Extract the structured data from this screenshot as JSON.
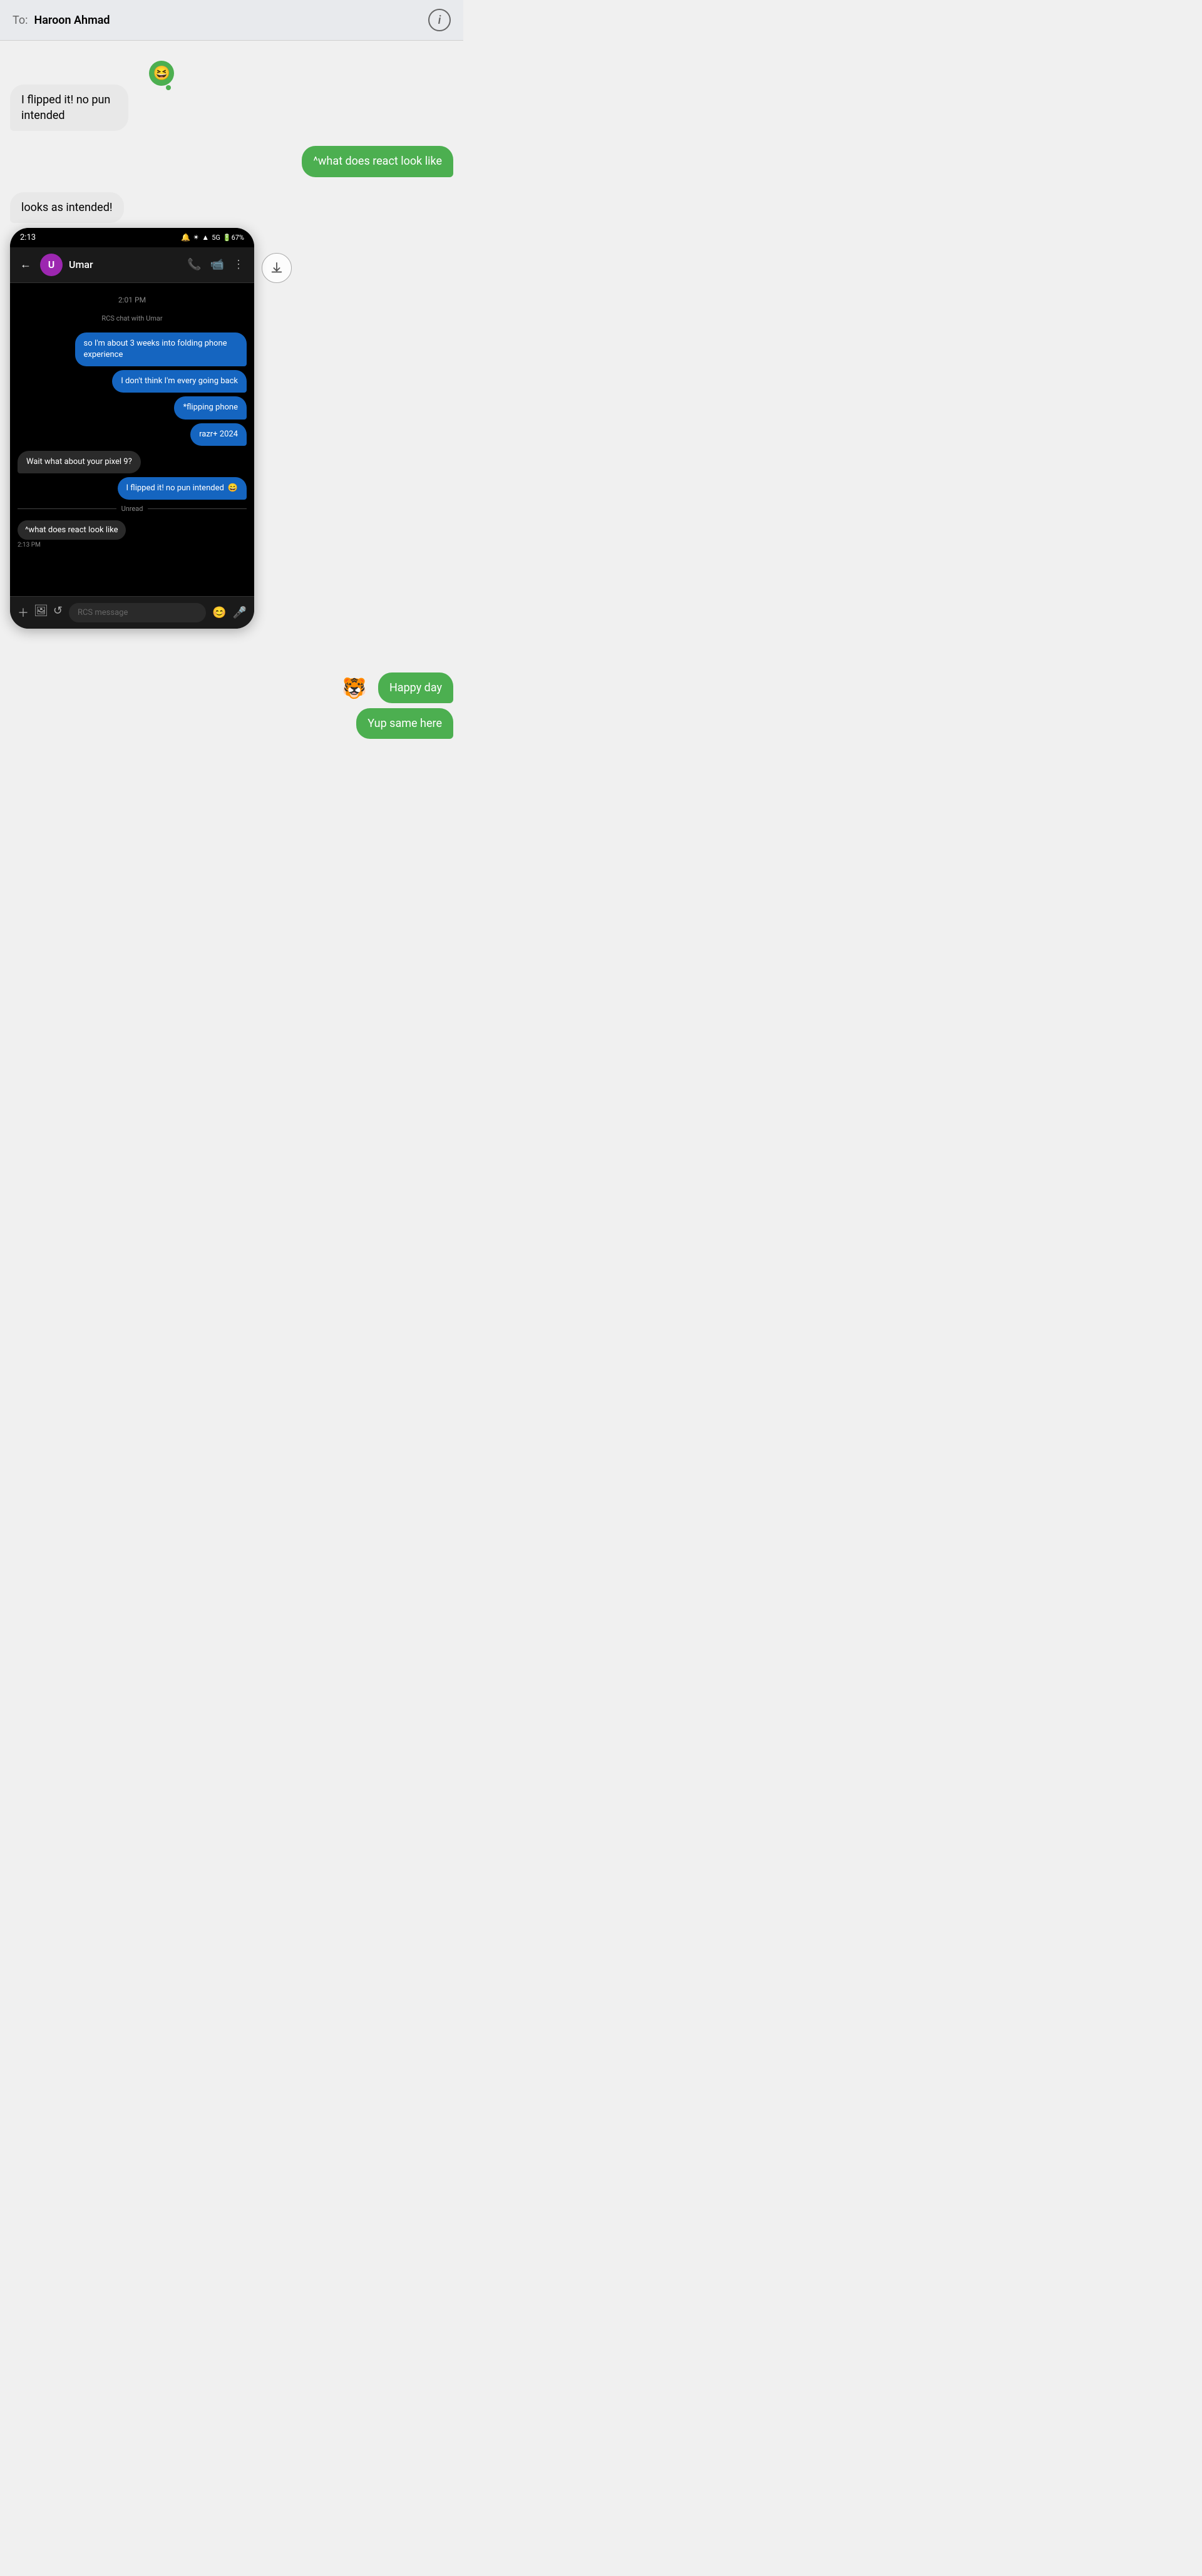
{
  "header": {
    "to_label": "To:",
    "contact_name": "Haroon Ahmad",
    "info_icon": "ℹ"
  },
  "messages": [
    {
      "id": "msg1",
      "type": "incoming",
      "text": "I flipped it! no pun intended",
      "reaction": "😆"
    },
    {
      "id": "msg2",
      "type": "outgoing",
      "text": "^what does react look like"
    },
    {
      "id": "msg3",
      "type": "incoming",
      "text": "looks as intended!"
    }
  ],
  "phone_screenshot": {
    "status_bar": {
      "time": "2:13",
      "icons": "🔔 ✴ ▲ 5G 🔋67%"
    },
    "contact": "Umar",
    "rcs_label": "RCS chat with Umar",
    "time_label": "2:01 PM",
    "chat_messages": [
      {
        "type": "out",
        "text": "so I'm about 3 weeks into folding phone experience"
      },
      {
        "type": "out",
        "text": "I don't think I'm every going back"
      },
      {
        "type": "out",
        "text": "*flipping phone"
      },
      {
        "type": "out",
        "text": "razr+ 2024"
      },
      {
        "type": "in",
        "text": "Wait what about your pixel 9?"
      },
      {
        "type": "out",
        "text": "I flipped it! no pun intended",
        "emoji": "😄"
      }
    ],
    "unread_label": "Unread",
    "unread_message": "^what does react look like",
    "unread_time": "2:13 PM",
    "input_placeholder": "RCS message"
  },
  "outgoing_messages_2": [
    {
      "id": "msg4",
      "type": "outgoing",
      "text": "Happy day",
      "avatar": "🐯"
    },
    {
      "id": "msg5",
      "type": "outgoing",
      "text": "Yup same here"
    }
  ],
  "icons": {
    "info": "ℹ",
    "download": "⬇",
    "back_arrow": "←",
    "phone_call": "📞",
    "video_call": "📹",
    "more_vert": "⋮",
    "add": "+",
    "attach": "📎",
    "emoji": "😊",
    "mic": "🎤"
  }
}
